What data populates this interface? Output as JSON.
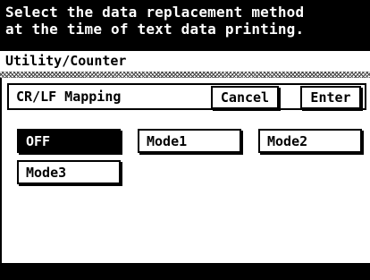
{
  "message": {
    "line1": "Select the data replacement method",
    "line2": "at the time of text data printing."
  },
  "menu_path": "Utility/Counter",
  "panel": {
    "title": "CR/LF Mapping",
    "cancel_label": "Cancel",
    "enter_label": "Enter"
  },
  "modes": {
    "selected": "OFF",
    "items": [
      "OFF",
      "Mode1",
      "Mode2",
      "Mode3"
    ]
  },
  "colors": {
    "background": "#ffffff",
    "foreground": "#000000",
    "selected_bg": "#000000",
    "selected_fg": "#ffffff"
  }
}
